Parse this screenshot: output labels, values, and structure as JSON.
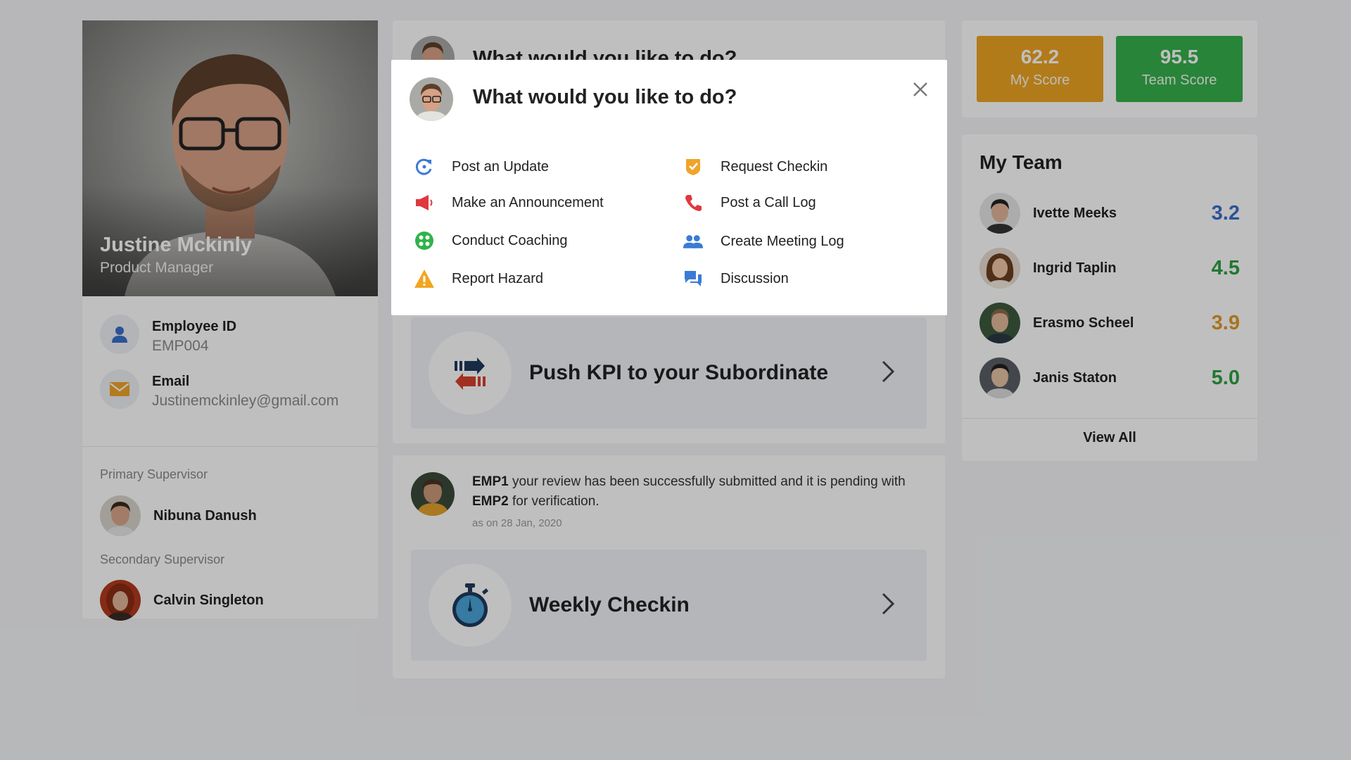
{
  "profile": {
    "name": "Justine Mckinly",
    "role": "Product Manager",
    "employee_id_label": "Employee ID",
    "employee_id": "EMP004",
    "email_label": "Email",
    "email": "Justinemckinley@gmail.com",
    "primary_supervisor_label": "Primary Supervisor",
    "primary_supervisor": "Nibuna Danush",
    "secondary_supervisor_label": "Secondary Supervisor",
    "secondary_supervisor": "Calvin Singleton"
  },
  "behind_card": {
    "title": "What would you like to do?"
  },
  "kpi_tile": {
    "label": "Push KPI to your Subordinate",
    "icon": "transfer-arrows-icon"
  },
  "notification": {
    "emp1": "EMP1",
    "text1": " your review has been successfully submitted and it is pending with ",
    "emp2": "EMP2",
    "text2": " for verification.",
    "date": "as on 28 Jan, 2020"
  },
  "checkin_tile": {
    "label": "Weekly Checkin",
    "icon": "stopwatch-icon"
  },
  "scores": {
    "my_score": "62.2",
    "my_score_label": "My Score",
    "my_score_color": "#eea423",
    "team_score": "95.5",
    "team_score_label": "Team Score",
    "team_score_color": "#36b14b"
  },
  "team": {
    "title": "My Team",
    "members": [
      {
        "name": "Ivette Meeks",
        "score": "3.2",
        "color": "#3a6fc9"
      },
      {
        "name": "Ingrid Taplin",
        "score": "4.5",
        "color": "#2ea043"
      },
      {
        "name": "Erasmo Scheel",
        "score": "3.9",
        "color": "#e09a2a"
      },
      {
        "name": "Janis Staton",
        "score": "5.0",
        "color": "#2ea043"
      }
    ],
    "view_all": "View All"
  },
  "modal": {
    "title": "What would you like to do?",
    "close_icon": "close-icon",
    "options": [
      {
        "label": "Post an Update",
        "icon": "refresh-icon"
      },
      {
        "label": "Request Checkin",
        "icon": "check-badge-icon"
      },
      {
        "label": "Make an Announcement",
        "icon": "megaphone-icon"
      },
      {
        "label": "Post a Call Log",
        "icon": "phone-icon"
      },
      {
        "label": "Conduct Coaching",
        "icon": "coaching-dots-icon"
      },
      {
        "label": "Create Meeting Log",
        "icon": "people-icon"
      },
      {
        "label": "Report Hazard",
        "icon": "warning-icon"
      },
      {
        "label": "Discussion",
        "icon": "chat-icon"
      }
    ]
  }
}
